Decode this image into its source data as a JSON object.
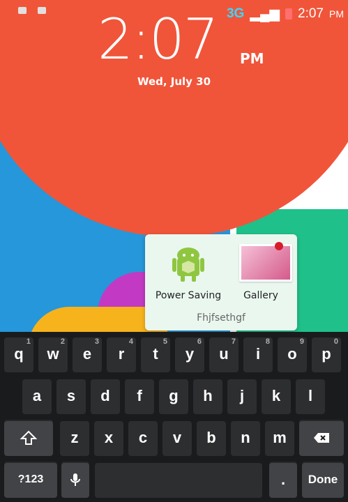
{
  "status": {
    "network": "3G",
    "time": "2:07",
    "ampm": "PM"
  },
  "clock": {
    "time": "2:07",
    "ampm": "PM",
    "date": "Wed, July 30"
  },
  "folder": {
    "apps": [
      {
        "name": "Power Saving",
        "icon": "android-icon"
      },
      {
        "name": "Gallery",
        "icon": "gallery-icon"
      }
    ],
    "title": "Fhjfsethgf"
  },
  "keyboard": {
    "row1": [
      {
        "letter": "q",
        "num": "1"
      },
      {
        "letter": "w",
        "num": "2"
      },
      {
        "letter": "e",
        "num": "3"
      },
      {
        "letter": "r",
        "num": "4"
      },
      {
        "letter": "t",
        "num": "5"
      },
      {
        "letter": "y",
        "num": "6"
      },
      {
        "letter": "u",
        "num": "7"
      },
      {
        "letter": "i",
        "num": "8"
      },
      {
        "letter": "o",
        "num": "9"
      },
      {
        "letter": "p",
        "num": "0"
      }
    ],
    "row2": [
      "a",
      "s",
      "d",
      "f",
      "g",
      "h",
      "j",
      "k",
      "l"
    ],
    "row3": [
      "z",
      "x",
      "c",
      "v",
      "b",
      "n",
      "m"
    ],
    "bottom": {
      "symbols": "?123",
      "period": ".",
      "done": "Done"
    }
  },
  "colors": {
    "orange": "#f0553a",
    "blue": "#2597da",
    "green": "#20c08a",
    "purple": "#c23ac3",
    "yellow": "#f7b31c"
  }
}
